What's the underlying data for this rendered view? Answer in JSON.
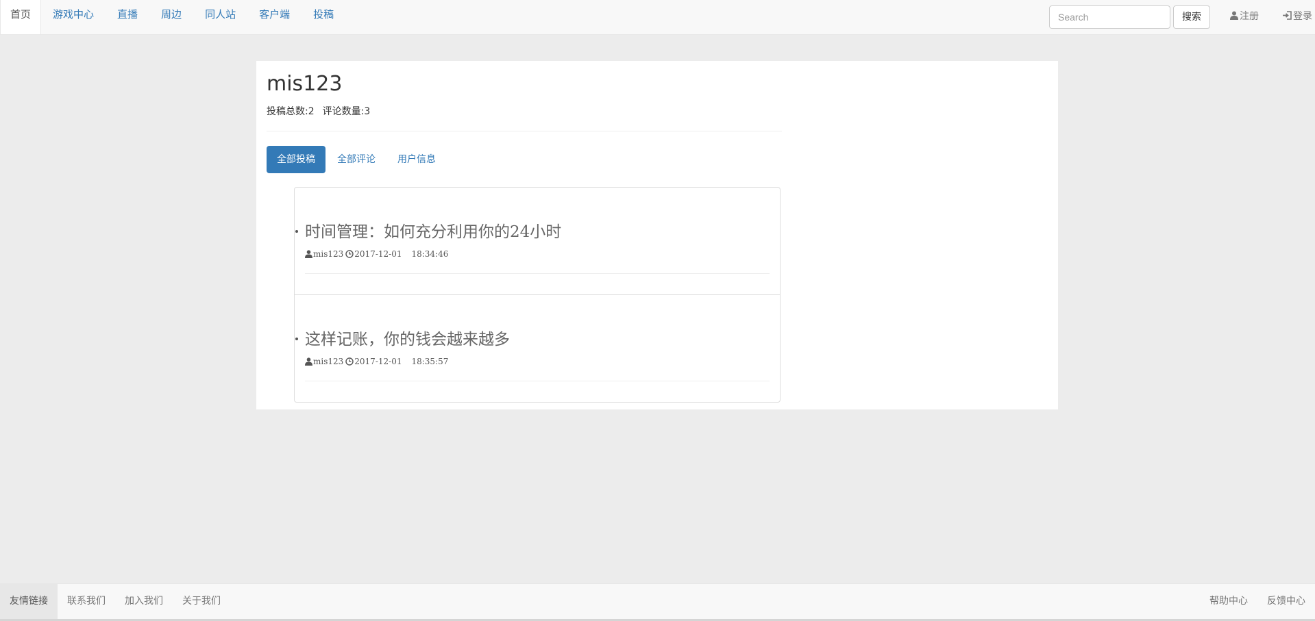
{
  "navbar": {
    "items": [
      {
        "label": "首页",
        "active": true
      },
      {
        "label": "游戏中心"
      },
      {
        "label": "直播"
      },
      {
        "label": "周边"
      },
      {
        "label": "同人站"
      },
      {
        "label": "客户端"
      },
      {
        "label": "投稿"
      }
    ],
    "search": {
      "placeholder": "Search",
      "value": "",
      "button_label": "搜索"
    },
    "register_label": "注册",
    "login_label": "登录",
    "icons": {
      "register": "user-icon",
      "login": "login-icon"
    }
  },
  "profile": {
    "username": "mis123",
    "stats": {
      "posts_label": "投稿总数:2",
      "comments_label": "评论数量:3"
    }
  },
  "tabs": [
    {
      "label": "全部投稿",
      "active": true
    },
    {
      "label": "全部评论"
    },
    {
      "label": "用户信息"
    }
  ],
  "posts": [
    {
      "title": "时间管理：如何充分利用你的24小时",
      "author": "mis123",
      "date": "2017-12-01",
      "time": "18:34:46"
    },
    {
      "title": "这样记账，你的钱会越来越多",
      "author": "mis123",
      "date": "2017-12-01",
      "time": "18:35:57"
    }
  ],
  "footer": {
    "left_items": [
      {
        "label": "友情链接",
        "active": true
      },
      {
        "label": "联系我们"
      },
      {
        "label": "加入我们"
      },
      {
        "label": "关于我们"
      }
    ],
    "right_items": [
      {
        "label": "帮助中心"
      },
      {
        "label": "反馈中心"
      }
    ]
  },
  "colors": {
    "accent": "#337ab7",
    "page_background": "#ececec",
    "navbar_background": "#f8f8f8"
  }
}
